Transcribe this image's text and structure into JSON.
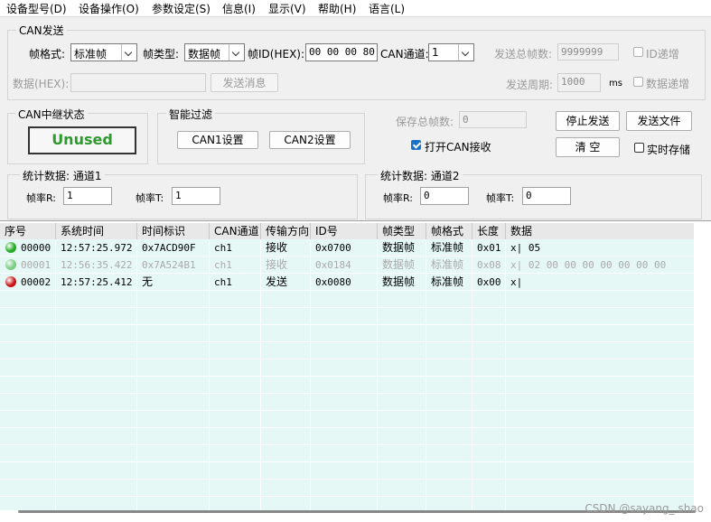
{
  "menu": [
    "设备型号(D)",
    "设备操作(O)",
    "参数设定(S)",
    "信息(I)",
    "显示(V)",
    "帮助(H)",
    "语言(L)"
  ],
  "can_send": {
    "title": "CAN发送",
    "frame_format_label": "帧格式:",
    "frame_format_value": "标准帧",
    "frame_type_label": "帧类型:",
    "frame_type_value": "数据帧",
    "frame_id_label": "帧ID(HEX):",
    "frame_id_value": "00 00 00 80",
    "channel_label": "CAN通道:",
    "channel_value": "1",
    "total_frames_label": "发送总帧数:",
    "total_frames_value": "9999999",
    "id_increment_label": "ID递增",
    "data_label": "数据(HEX):",
    "data_value": "",
    "send_button": "发送消息",
    "period_label": "发送周期:",
    "period_value": "1000",
    "period_unit": "ms",
    "data_increment_label": "数据递增"
  },
  "relay": {
    "title": "CAN中继状态",
    "status": "Unused"
  },
  "filter": {
    "title": "智能过滤",
    "can1_button": "CAN1设置",
    "can2_button": "CAN2设置"
  },
  "controls": {
    "saved_frames_label": "保存总帧数:",
    "saved_frames_value": "0",
    "open_receive_label": "打开CAN接收",
    "open_receive_checked": true,
    "stop_button": "停止发送",
    "send_file_button": "发送文件",
    "clear_button": "清 空",
    "realtime_save_label": "实时存储"
  },
  "stats1": {
    "title": "统计数据: 通道1",
    "rx_label": "帧率R:",
    "rx_value": "1",
    "tx_label": "帧率T:",
    "tx_value": "1"
  },
  "stats2": {
    "title": "统计数据: 通道2",
    "rx_label": "帧率R:",
    "rx_value": "0",
    "tx_label": "帧率T:",
    "tx_value": "0"
  },
  "table": {
    "headers": [
      "序号",
      "系统时间",
      "时间标识",
      "CAN通道",
      "传输方向",
      "ID号",
      "帧类型",
      "帧格式",
      "长度",
      "数据"
    ],
    "rows": [
      {
        "status": "green",
        "faded": false,
        "cells": [
          "00000",
          "12:57:25.972",
          "0x7ACD90F",
          "ch1",
          "接收",
          "0x0700",
          "数据帧",
          "标准帧",
          "0x01",
          "x| 05"
        ]
      },
      {
        "status": "green",
        "faded": true,
        "cells": [
          "00001",
          "12:56:35.422",
          "0x7A524B1",
          "ch1",
          "接收",
          "0x0184",
          "数据帧",
          "标准帧",
          "0x08",
          "x| 02 00 00 00 00 00 00 00"
        ]
      },
      {
        "status": "red",
        "faded": false,
        "cells": [
          "00002",
          "12:57:25.412",
          "无",
          "ch1",
          "发送",
          "0x0080",
          "数据帧",
          "标准帧",
          "0x00",
          "x|"
        ]
      }
    ]
  },
  "colors": {
    "status_green": "#2e9a2e",
    "dot_green": "#22aa22",
    "dot_red": "#cc1111",
    "table_bg": "#e6f8f6"
  },
  "watermark": "CSDN @sayang_ shao"
}
